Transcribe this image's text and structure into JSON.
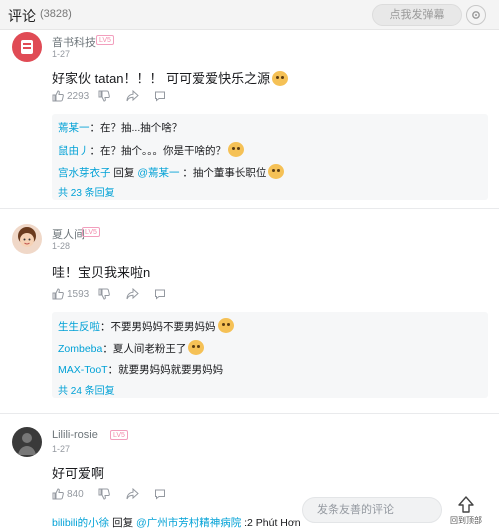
{
  "header": {
    "title": "评论",
    "count": "(3828)",
    "danmaku_placeholder": "点我发弹幕"
  },
  "comments": [
    {
      "user": "音书科技",
      "level": "LV5",
      "date": "1-27",
      "text": "好家伙 tatan！！！ 可可爱爱快乐之源",
      "likes": "2293",
      "replies": [
        {
          "name": "蔫某一",
          "text": "：在？抽...抽个啥？"
        },
        {
          "name": "鼠由丿",
          "text": "：在？抽个。。。你是干啥的？"
        },
        {
          "name": "宫水芽衣子",
          "mid": " 回复 ",
          "at": "@蔫某一",
          "text": " ：抽个董事长职位"
        }
      ],
      "more": "共 23 条回复"
    },
    {
      "user": "夏人间",
      "level": "LV5",
      "date": "1-28",
      "text": "哇！宝贝我来啦n",
      "likes": "1593",
      "replies": [
        {
          "name": "生生反啦",
          "text": "：不要男妈妈不要男妈妈"
        },
        {
          "name": "Zombeba",
          "text": "：夏人间老粉王了"
        },
        {
          "name": "MAX-TooT",
          "text": "：就要男妈妈就要男妈妈"
        }
      ],
      "more": "共 24 条回复"
    },
    {
      "user": "Lilili-rosie",
      "level": "LV5",
      "date": "1-27",
      "text": "好可爱啊",
      "likes": "840",
      "reply_preview": {
        "name": "bilibili的小徐",
        "mid": " 回复 ",
        "at": "@广州市芳村精神病院",
        "text": " :2 Phút Hơn"
      }
    }
  ],
  "bottom": {
    "input_placeholder": "发条友善的评论",
    "top_label": "回到顶部"
  },
  "colors": {
    "link": "#00a1d6",
    "level_pink": "#f28aab",
    "muted": "#9499a0"
  }
}
